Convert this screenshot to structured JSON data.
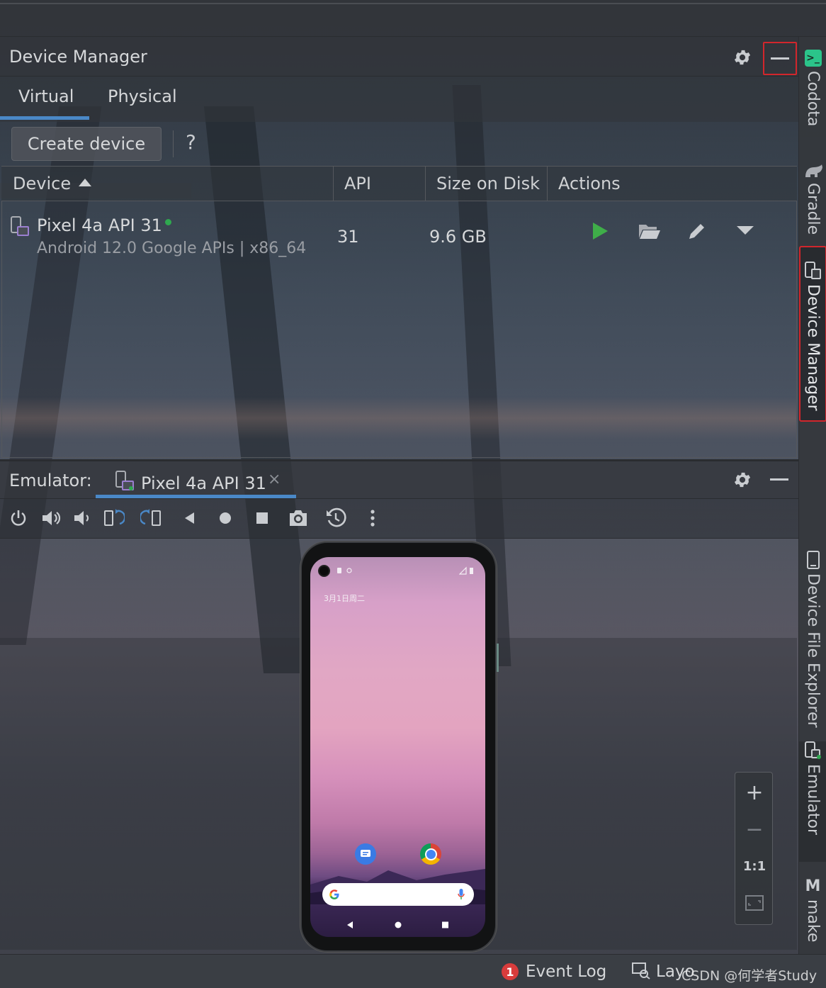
{
  "device_manager": {
    "title": "Device Manager",
    "tabs": [
      "Virtual",
      "Physical"
    ],
    "create_button": "Create device",
    "help": "?",
    "columns": {
      "device": "Device",
      "api": "API",
      "size": "Size on Disk",
      "actions": "Actions"
    },
    "rows": [
      {
        "name": "Pixel 4a API 31",
        "subtitle": "Android 12.0 Google APIs | x86_64",
        "api": "31",
        "size": "9.6 GB",
        "status_color": "#2fa84f"
      }
    ],
    "actions_icons": [
      "play-icon",
      "folder-open-icon",
      "edit-pencil-icon",
      "dropdown-arrow-icon"
    ]
  },
  "emulator": {
    "label": "Emulator:",
    "tab": "Pixel 4a API 31",
    "close": "×",
    "toolbar_icons": [
      "power-icon",
      "volume-up-icon",
      "volume-down-icon",
      "rotate-left-icon",
      "rotate-right-icon",
      "back-icon",
      "home-icon",
      "overview-icon",
      "screenshot-icon",
      "snapshot-icon",
      "more-icon"
    ],
    "phone": {
      "date": "3月1日周二"
    },
    "zoom": {
      "plus": "+",
      "minus": "−",
      "one_to_one": "1:1"
    }
  },
  "right_tools": [
    {
      "label": "Codota"
    },
    {
      "label": "Gradle"
    },
    {
      "label": "Device Manager",
      "active": true
    },
    {
      "label": "Device File Explorer"
    },
    {
      "label": "Emulator"
    },
    {
      "label": "make"
    }
  ],
  "status_bar": {
    "event_badge": "1",
    "event_log": "Event Log",
    "layout": "Layo",
    "watermark": "CSDN @何学者Study"
  },
  "colors": {
    "accent": "#4a88c7",
    "highlight": "#d2262c",
    "online": "#2fa84f",
    "play": "#3fae49"
  }
}
